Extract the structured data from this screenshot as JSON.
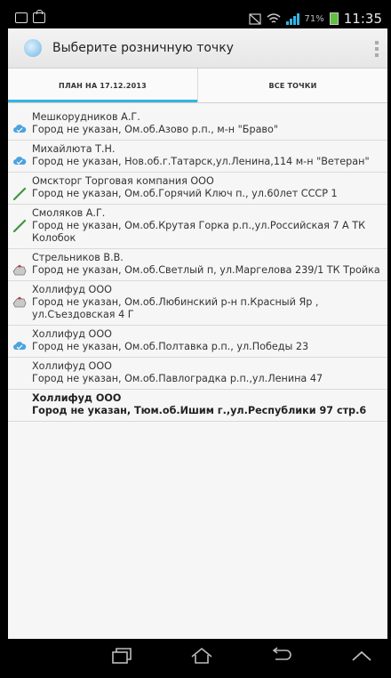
{
  "status_bar": {
    "time": "11:35",
    "battery_percent": "71%",
    "icons": [
      "email-icon",
      "bag-icon",
      "mute-icon",
      "wifi-icon",
      "signal-icon",
      "battery-icon"
    ]
  },
  "action_bar": {
    "title": "Выберите розничную точку",
    "overflow_icon": "overflow-menu-icon"
  },
  "tabs": [
    {
      "label": "ПЛАН НА 17.12.2013",
      "active": true
    },
    {
      "label": "ВСЕ ТОЧКИ",
      "active": false
    }
  ],
  "items": [
    {
      "name": "Мешкорудников А.Г.",
      "address": "Город не указан, Ом.об.Азово р.п., м-н \"Браво\"",
      "icon": "cloud-icon",
      "bold": false
    },
    {
      "name": "Михайлюта Т.Н.",
      "address": "Город не указан, Нов.об.г.Татарск,ул.Ленина,114 м-н \"Ветеран\"",
      "icon": "cloud-icon",
      "bold": false
    },
    {
      "name": "Омскторг Торговая компания ООО",
      "address": "Город не указан, Ом.об.Горячий Ключ п., ул.60лет СССР 1",
      "icon": "pencil-icon",
      "bold": false
    },
    {
      "name": "Смоляков А.Г.",
      "address": "Город не указан, Ом.об.Крутая Горка р.п.,ул.Российская 7 А ТК Колобок",
      "icon": "pencil-icon",
      "bold": false
    },
    {
      "name": "Стрельников В.В.",
      "address": "Город не указан, Ом.об.Светлый п, ул.Маргелова 239/1 ТК Тройка",
      "icon": "cart-icon",
      "bold": false
    },
    {
      "name": "Холлифуд ООО",
      "address": "Город не указан, Ом.об.Любинский р-н п.Красный Яр , ул.Съездовская 4 Г",
      "icon": "cart-icon",
      "bold": false
    },
    {
      "name": "Холлифуд ООО",
      "address": "Город не указан, Ом.об.Полтавка р.п., ул.Победы 23",
      "icon": "cloud-icon",
      "bold": false
    },
    {
      "name": "Холлифуд ООО",
      "address": "Город не указан, Ом.об.Павлоградка р.п.,ул.Ленина 47",
      "icon": "",
      "bold": false
    },
    {
      "name": "Холлифуд ООО",
      "address": "Город не указан, Тюм.об.Ишим г.,ул.Республики 97 стр.6",
      "icon": "",
      "bold": true
    }
  ],
  "nav_bar": {
    "icons": [
      "recent-apps-icon",
      "home-icon",
      "back-icon",
      "collapse-icon"
    ]
  },
  "colors": {
    "accent": "#33b5e5",
    "pencil": "#3a9a3a",
    "cart": "#c0392b",
    "cloud": "#4aa3df"
  }
}
